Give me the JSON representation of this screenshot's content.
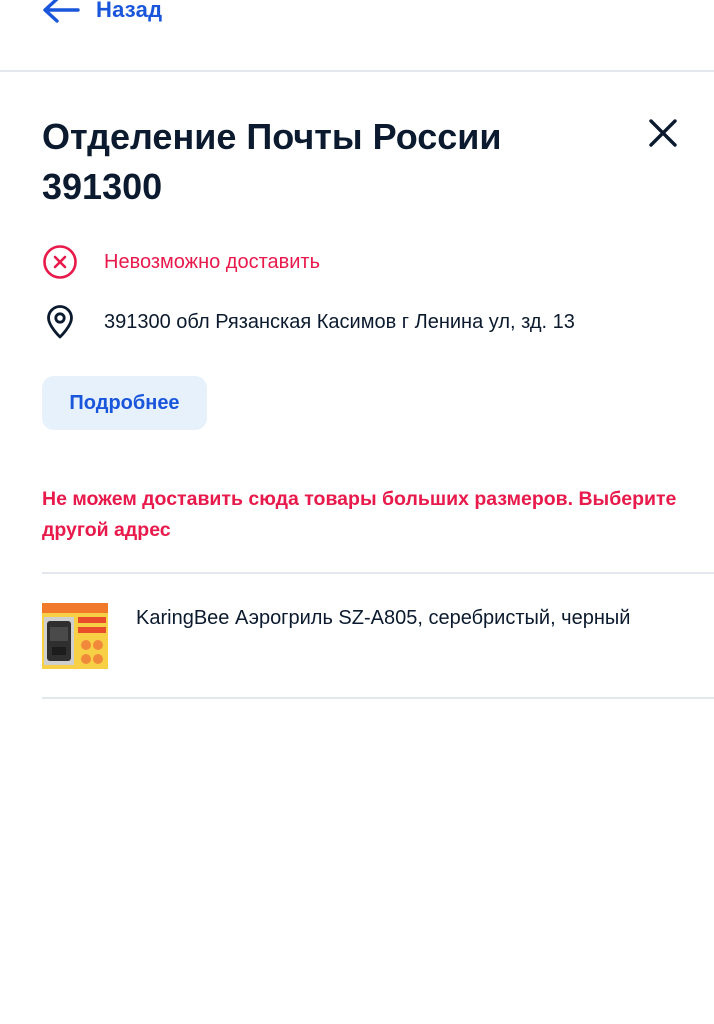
{
  "header": {
    "back_label": "Назад"
  },
  "pickup_point": {
    "title": "Отделение Почты России 391300",
    "status": "Невозможно доставить",
    "address": "391300 обл Рязанская Касимов г Ленина ул, зд. 13",
    "details_button": "Подробнее"
  },
  "warning": {
    "text": "Не можем доставить сюда товары больших размеров. Выберите другой адрес"
  },
  "product": {
    "name": "KaringBee Аэрогриль SZ-A805, серебристый, черный"
  },
  "icons": {
    "back": "arrow-left-icon",
    "close": "close-icon",
    "status": "cross-circle-icon",
    "address": "location-pin-icon"
  },
  "colors": {
    "accent": "#1a56db",
    "error": "#e8194b",
    "button_bg": "#e6f1fc",
    "text": "#0b1a2e",
    "divider": "#e4e8ee"
  }
}
